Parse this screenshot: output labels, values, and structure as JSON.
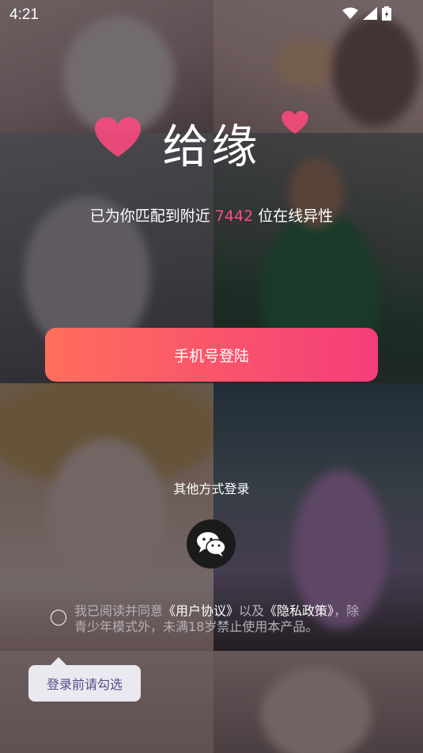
{
  "status_bar": {
    "time": "4:21"
  },
  "app": {
    "logo_text": "给缘"
  },
  "tagline": {
    "prefix": "已为你匹配到附近",
    "count": "7442",
    "suffix": "位在线异性"
  },
  "login": {
    "phone_button": "手机号登陆",
    "other_methods": "其他方式登录"
  },
  "agreement": {
    "prefix": "我已阅读并同意",
    "user_agreement": "《用户协议》",
    "and": "以及",
    "privacy_policy": "《隐私政策》",
    "suffix": "，除青少年模式外，未满18岁禁止使用本产品。"
  },
  "tooltip": {
    "text": "登录前请勾选"
  },
  "colors": {
    "accent": "#ff4a86",
    "button_start": "#ff6e5c",
    "button_end": "#f43d7a"
  }
}
